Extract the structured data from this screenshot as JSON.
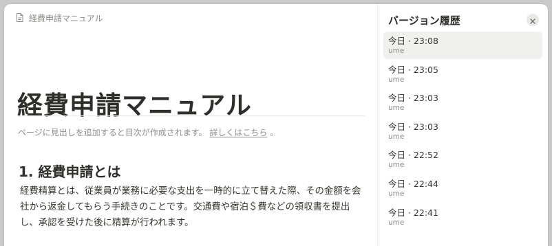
{
  "breadcrumb": {
    "icon": "page-icon",
    "label": "経費申請マニュアル"
  },
  "document": {
    "title": "経費申請マニュアル",
    "toc_note": "ページに見出しを追加すると目次が作成されます。",
    "toc_link": "詳しくはこちら",
    "toc_note_end": "。",
    "section_heading": "1. 経費申請とは",
    "body": "経費精算とは、従業員が業務に必要な支出を一時的に立て替えた際、その金額を会社から返金してもらう手続きのことです。交通費や宿泊＄費などの領収書を提出し、承認を受けた後に精算が行われます。"
  },
  "panel": {
    "title": "バージョン履歴",
    "close_icon": "close-icon",
    "versions": [
      {
        "time": "今日 · 23:08",
        "user": "ume",
        "selected": true
      },
      {
        "time": "今日 · 23:05",
        "user": "ume"
      },
      {
        "time": "今日 · 23:03",
        "user": "ume"
      },
      {
        "time": "今日 · 23:03",
        "user": "ume"
      },
      {
        "time": "今日 · 22:52",
        "user": "ume"
      },
      {
        "time": "今日 · 22:44",
        "user": "ume"
      },
      {
        "time": "今日 · 22:41",
        "user": "ume"
      }
    ]
  },
  "colors": {
    "background": "#c9c9c9",
    "window": "#ffffff",
    "text_primary": "#37352f",
    "text_muted": "#8e8c88",
    "selected_row": "#f0f0ef"
  }
}
